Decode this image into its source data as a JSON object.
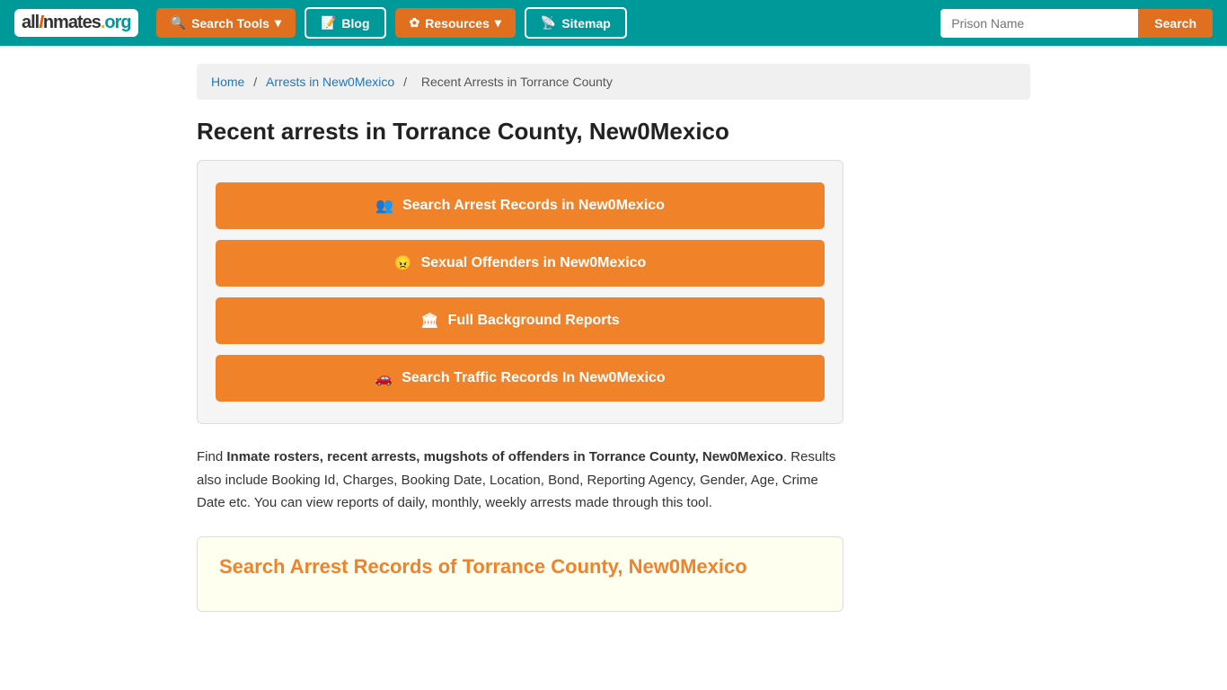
{
  "logo": {
    "text": "allInmates.org"
  },
  "nav": {
    "search_tools_label": "Search Tools",
    "blog_label": "Blog",
    "resources_label": "Resources",
    "sitemap_label": "Sitemap",
    "prison_name_placeholder": "Prison Name",
    "search_button_label": "Search"
  },
  "breadcrumb": {
    "home_label": "Home",
    "arrests_label": "Arrests in New0Mexico",
    "current_label": "Recent Arrests in Torrance County"
  },
  "page": {
    "title": "Recent arrests in Torrance County, New0Mexico",
    "action_buttons": [
      {
        "label": "Search Arrest Records in New0Mexico",
        "icon": "👥"
      },
      {
        "label": "Sexual Offenders in New0Mexico",
        "icon": "😠"
      },
      {
        "label": "Full Background Reports",
        "icon": "🏛"
      },
      {
        "label": "Search Traffic Records In New0Mexico",
        "icon": "🚗"
      }
    ],
    "description_intro": "Find ",
    "description_bold": "Inmate rosters, recent arrests, mugshots of offenders in Torrance County, New0Mexico",
    "description_rest": ". Results also include Booking Id, Charges, Booking Date, Location, Bond, Reporting Agency, Gender, Age, Crime Date etc. You can view reports of daily, monthly, weekly arrests made through this tool.",
    "search_section_title": "Search Arrest Records of Torrance County, New0Mexico"
  }
}
